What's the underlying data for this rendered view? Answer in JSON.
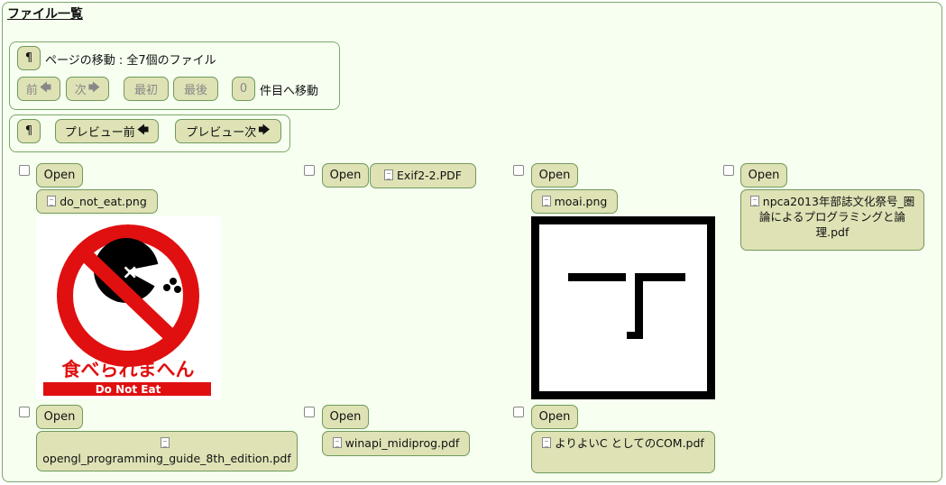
{
  "page": {
    "title": "ファイル一覧"
  },
  "nav": {
    "pilcrow": "¶",
    "move_text": "ページの移動 : 全7個のファイル",
    "prev": "前",
    "next": "次",
    "first": "最初",
    "last": "最後",
    "index_value": "0",
    "index_suffix": "件目へ移動"
  },
  "preview_nav": {
    "pilcrow": "¶",
    "prev": "プレビュー前",
    "next": "プレビュー次"
  },
  "open_label": "Open",
  "files": [
    {
      "name": "do_not_eat.png"
    },
    {
      "name": "Exif2-2.PDF"
    },
    {
      "name": "moai.png"
    },
    {
      "name": "npca2013年部誌文化祭号_圏論によるプログラミングと論理.pdf"
    },
    {
      "name": "opengl_programming_guide_8th_edition.pdf"
    },
    {
      "name": "winapi_midiprog.pdf"
    },
    {
      "name": "よりよいC としてのCOM.pdf"
    }
  ],
  "thumbnails": {
    "do_not_eat": {
      "jp_text": "食べられまへん",
      "en_text": "Do Not Eat"
    }
  },
  "colors": {
    "panel_bg": "#f6fff0",
    "border": "#7ba86a",
    "button_bg": "#dfe2b5",
    "sign_red": "#e01010"
  },
  "icons": {
    "arrow_left": "left-arrow-icon",
    "arrow_right": "right-arrow-icon",
    "file": "document-icon",
    "checkbox": "checkbox"
  }
}
